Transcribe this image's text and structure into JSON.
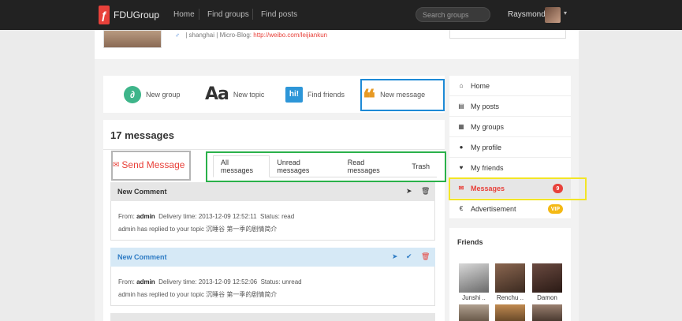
{
  "navbar": {
    "brand": "FDUGroup",
    "links": [
      "Home",
      "Find groups",
      "Find posts"
    ],
    "search_placeholder": "Search groups",
    "user_name": "Raysmond"
  },
  "profile": {
    "location": "shanghai",
    "microblog_label": "Micro-Blog:",
    "microblog_url": "http://weibo.com/leijiankun"
  },
  "actions": {
    "new_group": "New group",
    "new_topic": "New topic",
    "find_friends": "Find friends",
    "new_message": "New message",
    "icon_aa": "Aa",
    "icon_hi": "hi!"
  },
  "messages": {
    "count_title": "17 messages",
    "send_button": "Send Message",
    "tabs": [
      "All messages",
      "Unread messages",
      "Read messages",
      "Trash"
    ],
    "items": [
      {
        "title": "New Comment",
        "from_label": "From:",
        "from": "admin",
        "time_label": "Delivery time:",
        "time": "2013-12-09 12:52:11",
        "status_label": "Status:",
        "status": "read",
        "body": "admin has replied to your topic 沉睡谷 第一季的剧情简介"
      },
      {
        "title": "New Comment",
        "from_label": "From:",
        "from": "admin",
        "time_label": "Delivery time:",
        "time": "2013-12-09 12:52:06",
        "status_label": "Status:",
        "status": "unread",
        "body": "admin has replied to your topic 沉睡谷 第一季的剧情简介"
      }
    ]
  },
  "sidebar": {
    "items": [
      {
        "label": "Home",
        "icon": "home-icon"
      },
      {
        "label": "My posts",
        "icon": "document-icon"
      },
      {
        "label": "My groups",
        "icon": "grid-icon"
      },
      {
        "label": "My profile",
        "icon": "user-icon"
      },
      {
        "label": "My friends",
        "icon": "heart-icon"
      },
      {
        "label": "Messages",
        "icon": "envelope-icon",
        "badge": "9"
      },
      {
        "label": "Advertisement",
        "icon": "euro-icon",
        "badge": "VIP"
      }
    ]
  },
  "friends": {
    "title": "Friends",
    "list": [
      "Junshi ..",
      "Renchu ..",
      "Damon"
    ]
  },
  "colors": {
    "accent": "#e8413a",
    "highlight_blue": "#1e8ad6",
    "highlight_green": "#2ab14a",
    "highlight_yellow": "#f2e526"
  }
}
